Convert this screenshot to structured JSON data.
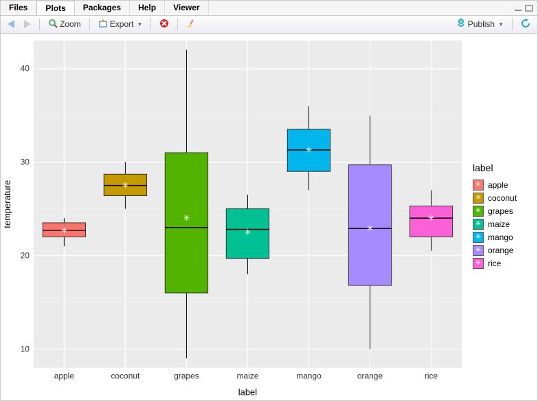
{
  "tabs": {
    "items": [
      "Files",
      "Plots",
      "Packages",
      "Help",
      "Viewer"
    ],
    "active_index": 1
  },
  "toolbar": {
    "zoom_label": "Zoom",
    "export_label": "Export",
    "publish_label": "Publish"
  },
  "chart_data": {
    "type": "boxplot",
    "xlabel": "label",
    "ylabel": "temperature",
    "ylim": [
      8,
      43
    ],
    "yticks": [
      10,
      20,
      30,
      40
    ],
    "categories": [
      "apple",
      "coconut",
      "grapes",
      "maize",
      "mango",
      "orange",
      "rice"
    ],
    "series": [
      {
        "name": "apple",
        "color": "#F8766D",
        "lower_whisker": 21.0,
        "q1": 22.0,
        "median": 22.7,
        "q3": 23.5,
        "upper_whisker": 24.0,
        "mean": 22.7
      },
      {
        "name": "coconut",
        "color": "#C49A00",
        "lower_whisker": 25.0,
        "q1": 26.4,
        "median": 27.5,
        "q3": 28.7,
        "upper_whisker": 30.0,
        "mean": 27.5
      },
      {
        "name": "grapes",
        "color": "#53B400",
        "lower_whisker": 9.0,
        "q1": 16.0,
        "median": 23.0,
        "q3": 31.0,
        "upper_whisker": 42.0,
        "mean": 24.0
      },
      {
        "name": "maize",
        "color": "#00C094",
        "lower_whisker": 18.0,
        "q1": 19.7,
        "median": 22.8,
        "q3": 25.0,
        "upper_whisker": 26.5,
        "mean": 22.5
      },
      {
        "name": "mango",
        "color": "#00B6EB",
        "lower_whisker": 27.0,
        "q1": 29.0,
        "median": 31.3,
        "q3": 33.5,
        "upper_whisker": 36.0,
        "mean": 31.3
      },
      {
        "name": "orange",
        "color": "#A58AFF",
        "lower_whisker": 10.0,
        "q1": 16.8,
        "median": 22.9,
        "q3": 29.7,
        "upper_whisker": 35.0,
        "mean": 22.9
      },
      {
        "name": "rice",
        "color": "#FB61D7",
        "lower_whisker": 20.5,
        "q1": 22.0,
        "median": 24.0,
        "q3": 25.3,
        "upper_whisker": 27.0,
        "mean": 24.0
      }
    ],
    "legend_title": "label"
  }
}
